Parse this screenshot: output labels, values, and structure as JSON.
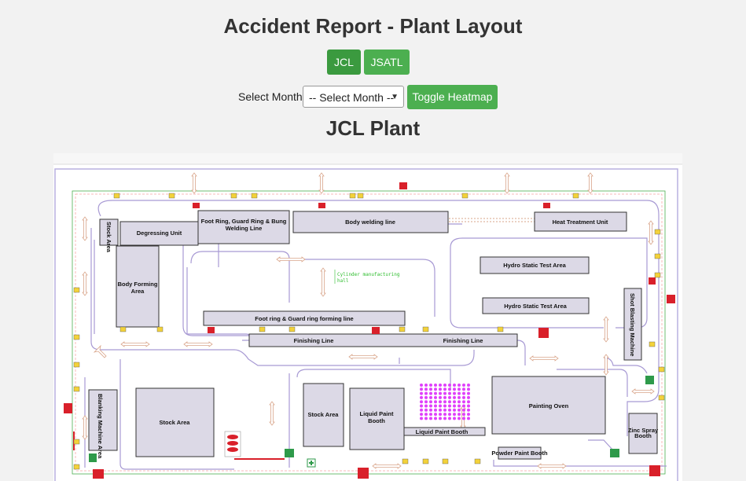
{
  "header": {
    "title": "Accident Report - Plant Layout"
  },
  "plant_buttons": [
    {
      "label": "JCL",
      "active": true
    },
    {
      "label": "JSATL",
      "active": false
    }
  ],
  "filters": {
    "month_label": "Select Month:",
    "month_selected": "-- Select Month --",
    "heatmap_button": "Toggle Heatmap"
  },
  "plant": {
    "title": "JCL Plant"
  },
  "layout": {
    "areas": {
      "stock_area_left_vertical": "Stock Area",
      "degressing_unit": "Degressing Unit",
      "foot_ring_welding": [
        "Foot Ring, Guard Ring & Bung",
        "Welding Line"
      ],
      "body_welding_line": "Body welding line",
      "heat_treatment_unit": "Heat Treatment Unit",
      "body_forming_area": [
        "Body Forming",
        "Area"
      ],
      "cylinder_hall": [
        "Cylinder manufacturing",
        "hall"
      ],
      "hydro_test_1": "Hydro Static Test Area",
      "hydro_test_2": "Hydro Static Test Area",
      "shot_blasting": "Shot Blasting Machine",
      "foot_ring_forming": "Foot ring & Guard ring forming line",
      "finishing_line_1": "Finishing Line",
      "finishing_line_2": "Finishing Line",
      "blanking_machine": "Blanking Machine Area",
      "stock_area_big": "Stock Area",
      "stock_area_mid": "Stock Area",
      "liquid_paint_booth": [
        "Liquid Paint",
        "Booth"
      ],
      "liquid_paint_booth_strip": "Liquid Paint Booth",
      "painting_oven": "Painting Oven",
      "powder_paint_booth": "Powder Paint Booth",
      "zinc_spray_booth": [
        "Zinc Spray",
        "Booth"
      ]
    }
  },
  "colors": {
    "button_green": "#4caf50",
    "button_green_active": "#3b9a3f",
    "block_fill": "#dcd9e6",
    "aisle_stroke": "#a89ad4",
    "boundary_green": "#4caf50",
    "paint_dots": "#e040fb",
    "fire_red": "#d9202a",
    "exit_green": "#2e9a4a"
  }
}
